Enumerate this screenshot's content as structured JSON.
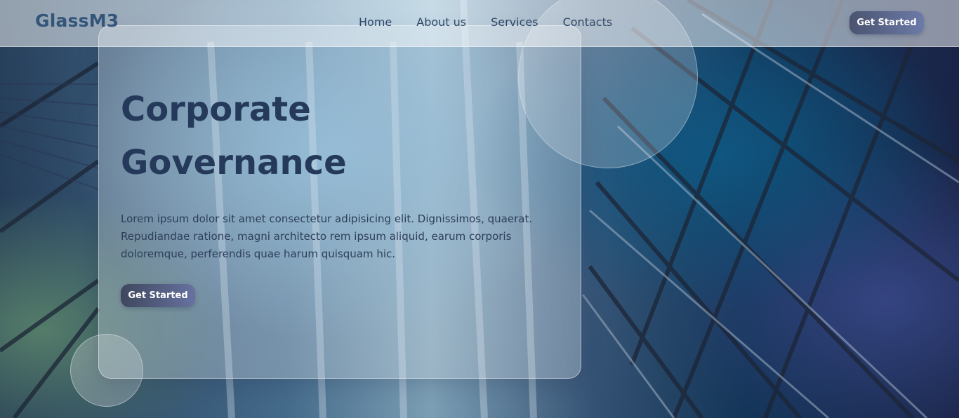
{
  "brand": {
    "name": "GlassM3"
  },
  "nav": {
    "items": [
      {
        "label": "Home"
      },
      {
        "label": "About us"
      },
      {
        "label": "Services"
      },
      {
        "label": "Contacts"
      }
    ],
    "cta_label": "Get Started"
  },
  "hero": {
    "title_line1": "Corporate",
    "title_line2": "Governance",
    "description": "Lorem ipsum dolor sit amet consectetur adipisicing elit. Dignissimos, quaerat. Repudiandae ratione, magni architecto rem ipsum aliquid, earum corporis doloremque, perferendis quae harum quisquam hic.",
    "cta_label": "Get Started"
  },
  "colors": {
    "accent_dark": "#3f475e",
    "accent_light": "#6c7aa8",
    "heading": "#253a5a",
    "logo": "#34557a"
  }
}
